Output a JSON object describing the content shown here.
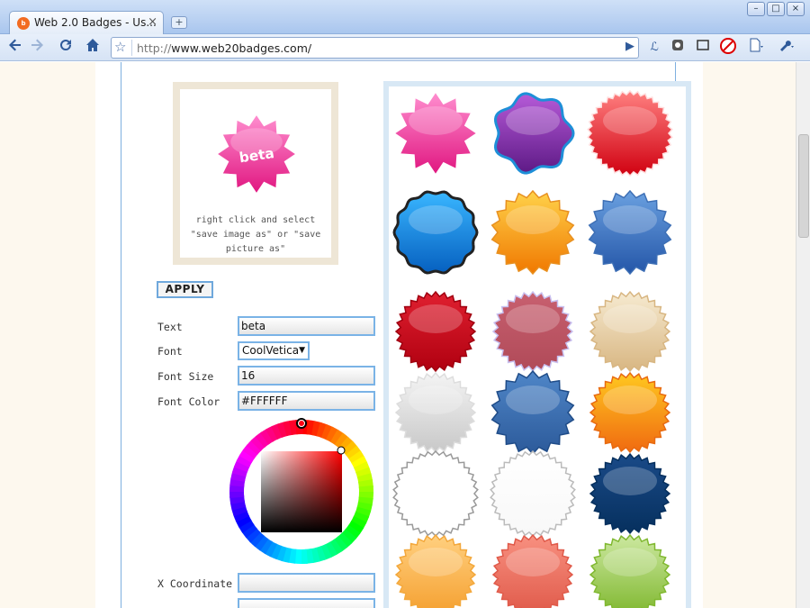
{
  "browser": {
    "tab_title": "Web 2.0 Badges - Us...",
    "favicon_text": "b",
    "tab_close": "×",
    "new_tab": "+",
    "url_scheme": "http://",
    "url_host": "www.web20badges.com/",
    "window_buttons": [
      "–",
      "□",
      "×"
    ]
  },
  "preview": {
    "badge_text": "beta",
    "hint": "right click and select \"save image as\" or \"save picture as\""
  },
  "form": {
    "apply_label": "APPLY",
    "text_label": "Text",
    "text_value": "beta",
    "font_label": "Font",
    "font_value": "CoolVetica",
    "font_size_label": "Font Size",
    "font_size_value": "16",
    "font_color_label": "Font Color",
    "font_color_value": "#FFFFFF",
    "x_label": "X Coordinate",
    "x_value": ""
  },
  "colors": {
    "accent_border": "#7ab3e6",
    "page_bg": "#fdf8ee"
  },
  "badges": [
    {
      "name": "pink-star",
      "shape": "star",
      "c1": "#ff8fd0",
      "c2": "#e0157f",
      "stroke": "#ffffff"
    },
    {
      "name": "purple-star",
      "shape": "blob",
      "c1": "#b65ad8",
      "c2": "#5e1a86",
      "stroke": "#1e8fd8"
    },
    {
      "name": "red-shiny",
      "shape": "serrated",
      "c1": "#ff8080",
      "c2": "#d00010",
      "stroke": "#ffdddd"
    },
    {
      "name": "blue-wavy",
      "shape": "wavy",
      "c1": "#39b6ff",
      "c2": "#0660c0",
      "stroke": "#222222"
    },
    {
      "name": "orange-burst",
      "shape": "burst",
      "c1": "#ffd24a",
      "c2": "#f07800",
      "stroke": "#e89020"
    },
    {
      "name": "blue-burst",
      "shape": "burst",
      "c1": "#6aa0e0",
      "c2": "#2456a8",
      "stroke": "#3d6fb5"
    },
    {
      "name": "red-seal",
      "shape": "seal",
      "c1": "#e02030",
      "c2": "#b00010",
      "stroke": "#a00010"
    },
    {
      "name": "rose-seal",
      "shape": "seal",
      "c1": "#c86070",
      "c2": "#b04a58",
      "stroke": "#c8c0f0"
    },
    {
      "name": "parchment-seal",
      "shape": "seal",
      "c1": "#f6ead0",
      "c2": "#d8b682",
      "stroke": "#d8b682"
    },
    {
      "name": "silver-seal",
      "shape": "seal",
      "c1": "#f4f4f4",
      "c2": "#c8c8c8",
      "stroke": "#dddddd"
    },
    {
      "name": "steel-blue-star",
      "shape": "burst",
      "c1": "#4f86c8",
      "c2": "#2c5a9a",
      "stroke": "#1f4c88"
    },
    {
      "name": "orange-gloss",
      "shape": "seal",
      "c1": "#ffc820",
      "c2": "#f06a10",
      "stroke": "#e86a10"
    },
    {
      "name": "white-outline",
      "shape": "serrated",
      "c1": "#ffffff",
      "c2": "#ffffff",
      "stroke": "#999999"
    },
    {
      "name": "white-plain",
      "shape": "serrated",
      "c1": "#ffffff",
      "c2": "#f8f8f8",
      "stroke": "#bbbbbb"
    },
    {
      "name": "navy-seal",
      "shape": "seal",
      "c1": "#1a4a88",
      "c2": "#06305e",
      "stroke": "#06305e"
    },
    {
      "name": "peach-seal",
      "shape": "seal",
      "c1": "#ffd080",
      "c2": "#f5a030",
      "stroke": "#f3a83c"
    },
    {
      "name": "salmon-seal",
      "shape": "seal",
      "c1": "#f89080",
      "c2": "#e05a4a",
      "stroke": "#e05a4a"
    },
    {
      "name": "green-seal",
      "shape": "seal",
      "c1": "#cce8a0",
      "c2": "#80b830",
      "stroke": "#80b830"
    }
  ]
}
